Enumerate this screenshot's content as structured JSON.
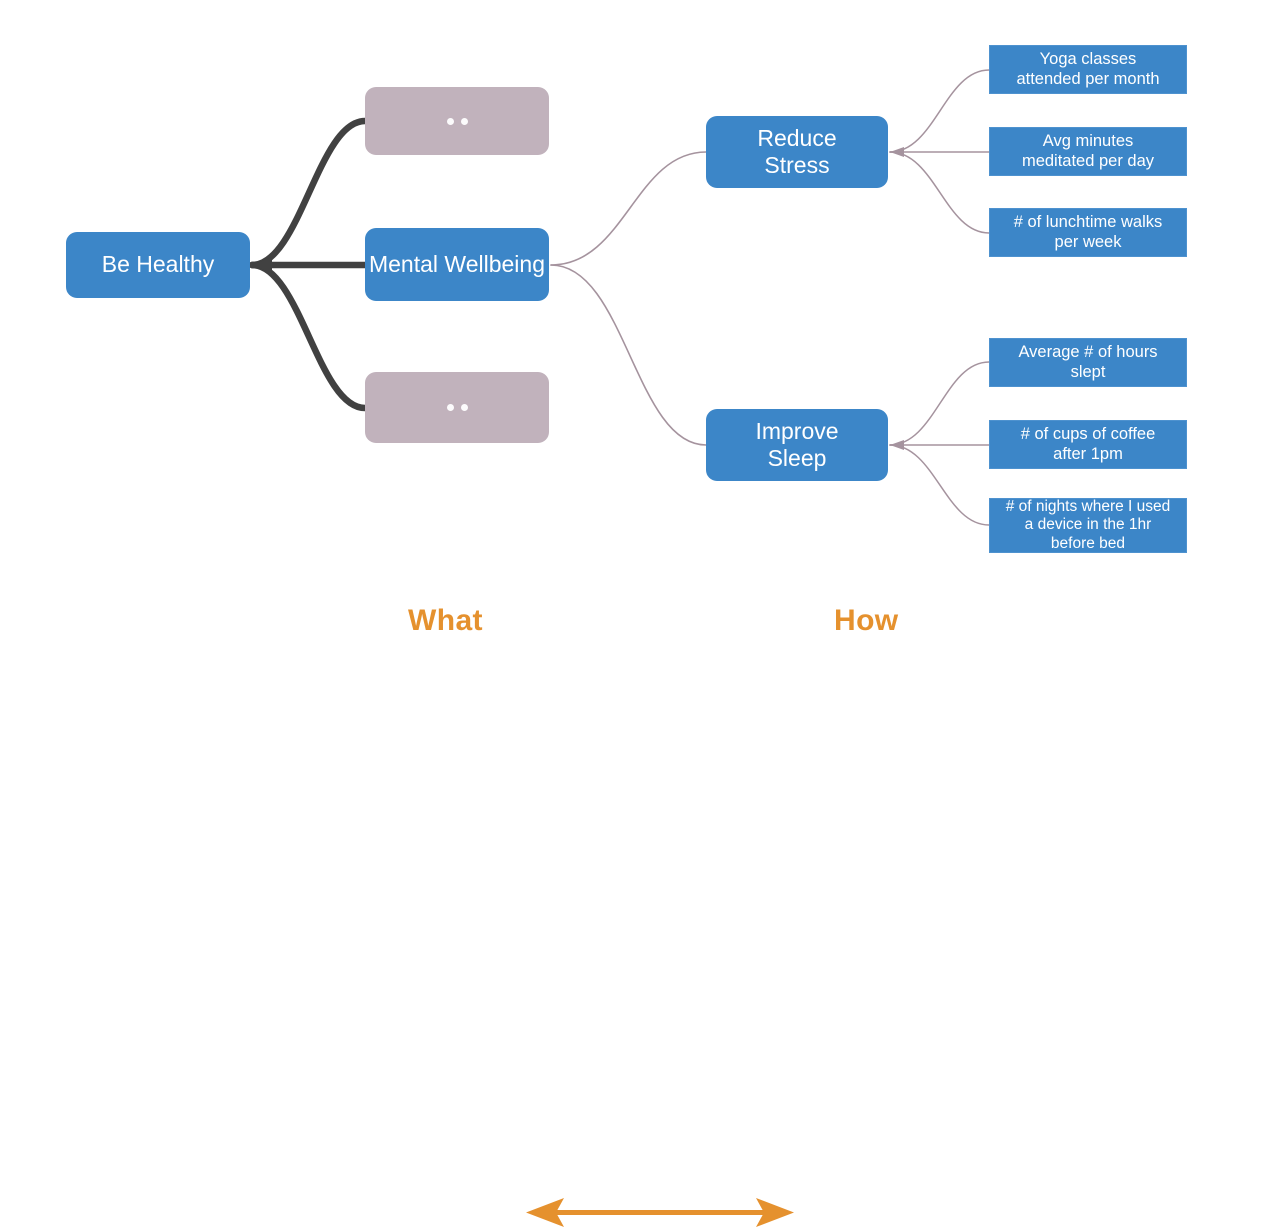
{
  "diagram": {
    "title_goal": "Be Healthy",
    "theme": {
      "blue": "#3c86c8",
      "muted": "#c1b2bc",
      "orange": "#e5912e",
      "dark_edge": "#414141",
      "light_edge": "#a5939e",
      "background": "#ffffff"
    },
    "goal": {
      "label": "Be Healthy"
    },
    "themes": [
      {
        "label": "",
        "placeholder_dots": 2,
        "kind": "collapsed"
      },
      {
        "label": "Mental Wellbeing",
        "kind": "active"
      },
      {
        "label": "",
        "placeholder_dots": 2,
        "kind": "collapsed"
      }
    ],
    "objectives": [
      {
        "label": "Reduce Stress",
        "line1": "Reduce",
        "line2": "Stress"
      },
      {
        "label": "Improve Sleep",
        "line1": "Improve",
        "line2": "Sleep"
      }
    ],
    "metrics": {
      "reduce_stress": [
        {
          "line1": "Yoga classes",
          "line2": "attended per month",
          "line3": ""
        },
        {
          "line1": "Avg minutes",
          "line2": "meditated per day",
          "line3": ""
        },
        {
          "line1": "# of lunchtime walks",
          "line2": "per week",
          "line3": ""
        }
      ],
      "improve_sleep": [
        {
          "line1": "Average # of hours",
          "line2": "slept",
          "line3": ""
        },
        {
          "line1": "# of cups of coffee",
          "line2": "after 1pm",
          "line3": ""
        },
        {
          "line1": "# of nights where I used",
          "line2": "a device in the 1hr",
          "line3": "before bed"
        }
      ]
    },
    "legend": {
      "left_label": "What",
      "right_label": "How",
      "arrow": "double-headed-horizontal-arrow"
    }
  }
}
